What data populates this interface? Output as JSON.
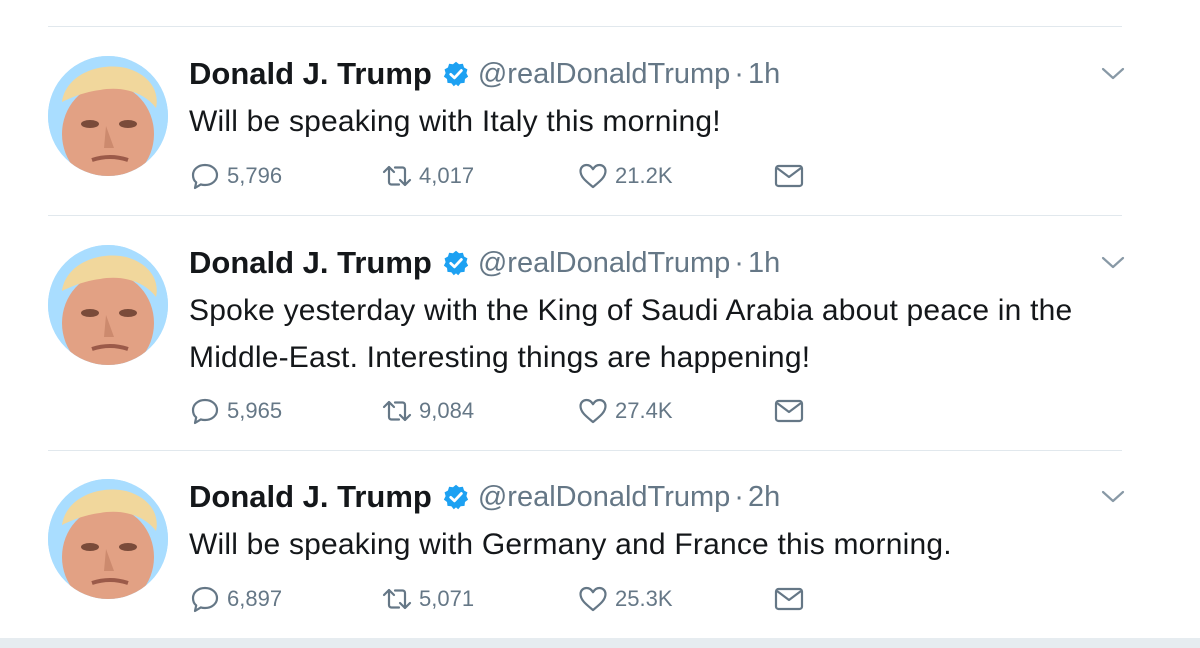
{
  "tweets": [
    {
      "name": "Donald J. Trump",
      "handle": "@realDonaldTrump",
      "sep": "·",
      "time": "1h",
      "text": "Will be speaking with Italy this morning!",
      "replies": "5,796",
      "retweets": "4,017",
      "likes": "21.2K"
    },
    {
      "name": "Donald J. Trump",
      "handle": "@realDonaldTrump",
      "sep": "·",
      "time": "1h",
      "text": "Spoke yesterday with the King of Saudi Arabia about peace in the Middle-East. Interesting things are happening!",
      "replies": "5,965",
      "retweets": "9,084",
      "likes": "27.4K"
    },
    {
      "name": "Donald J. Trump",
      "handle": "@realDonaldTrump",
      "sep": "·",
      "time": "2h",
      "text": "Will be speaking with Germany and France this morning.",
      "replies": "6,897",
      "retweets": "5,071",
      "likes": "25.3K"
    }
  ],
  "icons": {
    "reply": "reply-icon",
    "retweet": "retweet-icon",
    "like": "heart-icon",
    "dm": "mail-icon",
    "verified": "verified-badge-icon",
    "more": "chevron-down-icon"
  },
  "colors": {
    "verified": "#1da1f2",
    "muted": "#657786",
    "divider": "#e1e8ed"
  }
}
